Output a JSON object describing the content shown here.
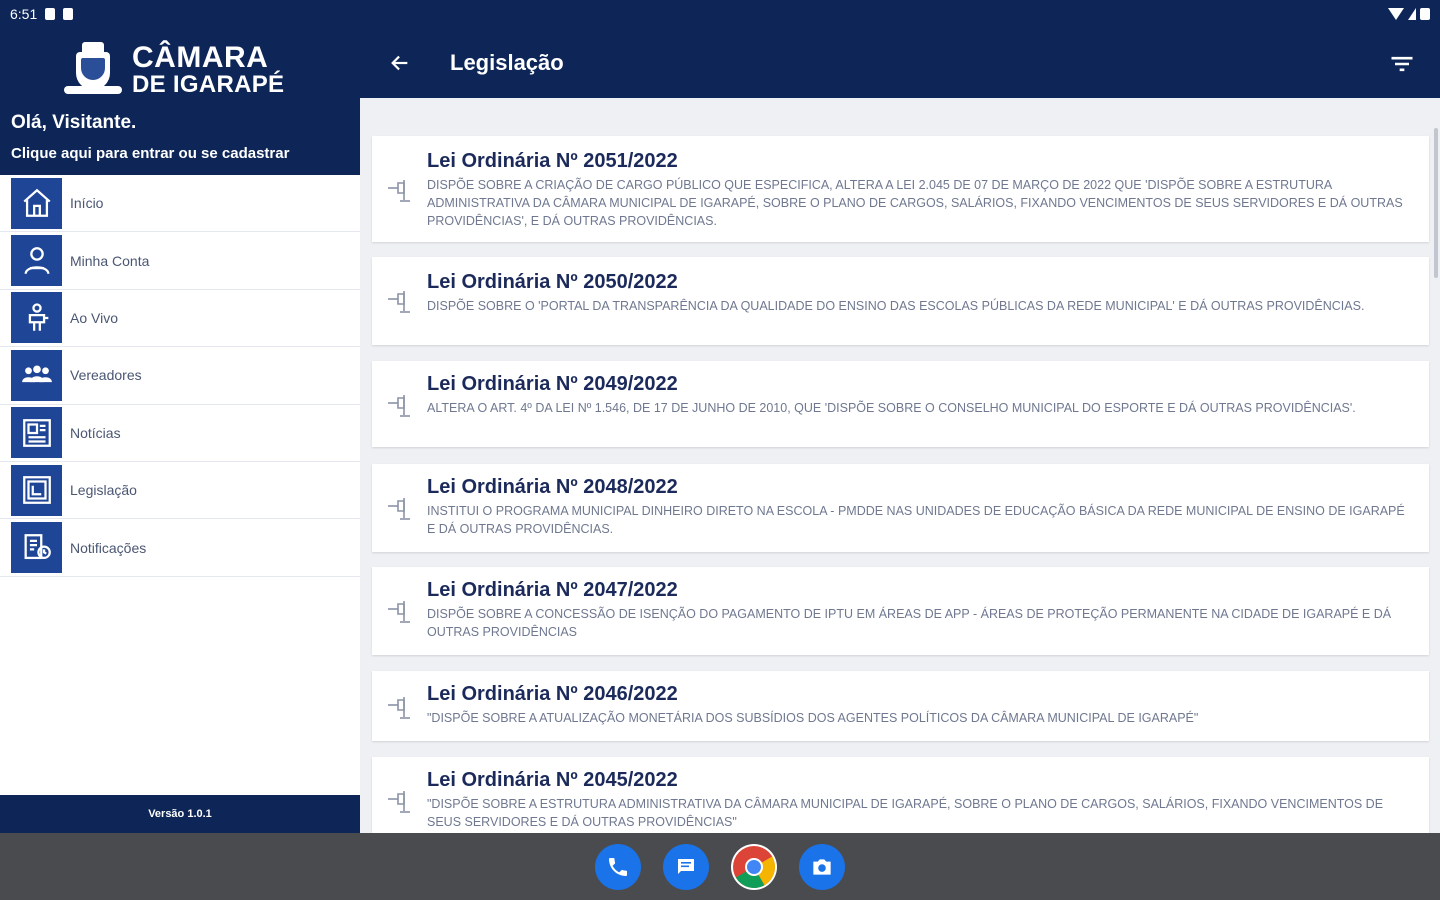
{
  "statusbar": {
    "time": "6:51"
  },
  "drawer": {
    "logo_line1": "CÂMARA",
    "logo_line2": "DE IGARAPÉ",
    "greeting": "Olá, Visitante.",
    "login_prompt": "Clique aqui para entrar ou se cadastrar",
    "items": [
      {
        "label": "Início",
        "icon": "home-icon"
      },
      {
        "label": "Minha Conta",
        "icon": "user-icon"
      },
      {
        "label": "Ao Vivo",
        "icon": "live-icon"
      },
      {
        "label": "Vereadores",
        "icon": "people-icon"
      },
      {
        "label": "Notícias",
        "icon": "news-icon"
      },
      {
        "label": "Legislação",
        "icon": "law-book-icon"
      },
      {
        "label": "Notificações",
        "icon": "notifications-icon"
      }
    ],
    "version": "Versão 1.0.1"
  },
  "appbar": {
    "title": "Legislação"
  },
  "laws": [
    {
      "title": "Lei Ordinária Nº 2051/2022",
      "description": "DISPÕE SOBRE A CRIAÇÃO DE CARGO PÚBLICO QUE ESPECIFICA, ALTERA A LEI 2.045 DE 07 DE MARÇO DE 2022 QUE 'DISPÕE SOBRE A ESTRUTURA ADMINISTRATIVA DA CÂMARA MUNICIPAL DE IGARAPÉ, SOBRE O PLANO DE CARGOS, SALÁRIOS, FIXANDO VENCIMENTOS DE SEUS SERVIDORES E DÁ OUTRAS PROVIDÊNCIAS', E DÁ OUTRAS PROVIDÊNCIAS."
    },
    {
      "title": "Lei Ordinária Nº 2050/2022",
      "description": "DISPÕE SOBRE O 'PORTAL DA TRANSPARÊNCIA DA QUALIDADE DO ENSINO DAS ESCOLAS PÚBLICAS DA REDE MUNICIPAL' E DÁ OUTRAS PROVIDÊNCIAS."
    },
    {
      "title": "Lei Ordinária Nº 2049/2022",
      "description": "ALTERA O ART. 4º DA LEI Nº 1.546, DE 17 DE JUNHO DE 2010, QUE 'DISPÕE SOBRE O CONSELHO MUNICIPAL DO ESPORTE E DÁ OUTRAS PROVIDÊNCIAS'."
    },
    {
      "title": "Lei Ordinária Nº 2048/2022",
      "description": "INSTITUI O PROGRAMA MUNICIPAL DINHEIRO DIRETO NA ESCOLA - PMDDE NAS UNIDADES DE EDUCAÇÃO BÁSICA DA REDE MUNICIPAL DE ENSINO DE IGARAPÉ E DÁ OUTRAS PROVIDÊNCIAS."
    },
    {
      "title": "Lei Ordinária Nº 2047/2022",
      "description": "DISPÕE SOBRE A CONCESSÃO DE ISENÇÃO DO PAGAMENTO DE IPTU EM ÁREAS DE APP - ÁREAS DE PROTEÇÃO PERMANENTE NA CIDADE DE IGARAPÉ E DÁ OUTRAS PROVIDÊNCIAS"
    },
    {
      "title": "Lei Ordinária Nº 2046/2022",
      "description": "\"DISPÕE SOBRE A ATUALIZAÇÃO MONETÁRIA DOS SUBSÍDIOS DOS AGENTES POLÍTICOS DA CÂMARA MUNICIPAL DE IGARAPÉ\""
    },
    {
      "title": "Lei Ordinária Nº 2045/2022",
      "description": "\"DISPÕE SOBRE A ESTRUTURA ADMINISTRATIVA DA CÂMARA MUNICIPAL DE IGARAPÉ, SOBRE O PLANO DE CARGOS, SALÁRIOS, FIXANDO VENCIMENTOS DE SEUS SERVIDORES E DÁ OUTRAS PROVIDÊNCIAS\""
    }
  ],
  "dock": [
    {
      "name": "phone-app-icon",
      "color": "#1a73e8"
    },
    {
      "name": "messages-app-icon",
      "color": "#1a73e8"
    },
    {
      "name": "chrome-app-icon",
      "color": "#ffffff"
    },
    {
      "name": "camera-app-icon",
      "color": "#1a73e8"
    }
  ],
  "colors": {
    "primary": "#0d2657",
    "menu_icon_bg": "#1f4597",
    "content_bg": "#eef0f3"
  }
}
